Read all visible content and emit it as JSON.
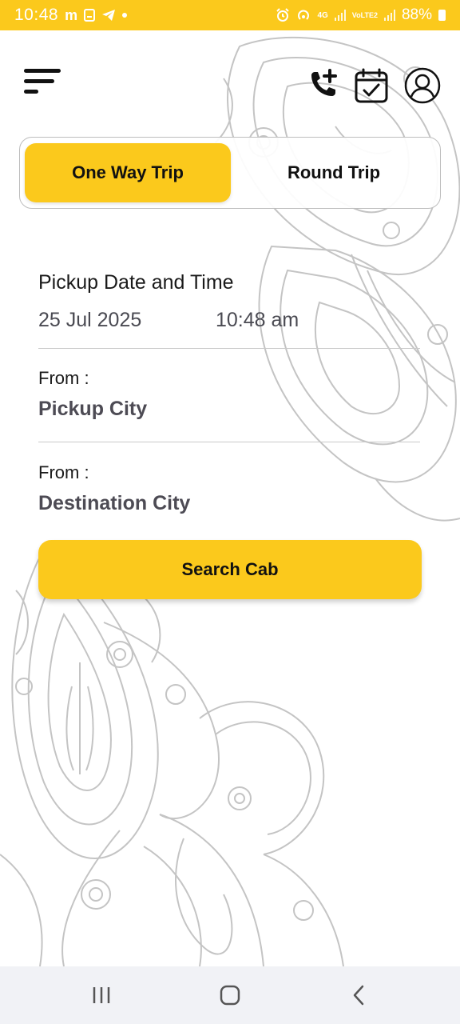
{
  "status_bar": {
    "time": "10:48",
    "left_glyph": "m",
    "network_1": "4G",
    "network_2": "VoLTE2",
    "battery": "88%"
  },
  "header": {
    "menu_icon": "hamburger-icon",
    "icons": [
      "add-call-icon",
      "calendar-check-icon",
      "profile-icon"
    ]
  },
  "trip_toggle": {
    "tabs": [
      {
        "label": "One Way Trip",
        "active": true
      },
      {
        "label": "Round Trip",
        "active": false
      }
    ]
  },
  "form": {
    "pickup_label": "Pickup Date and Time",
    "date": "25 Jul 2025",
    "time": "10:48 am",
    "from_label_1": "From :",
    "pickup_city": "Pickup City",
    "from_label_2": "From :",
    "destination_city": "Destination City"
  },
  "search_button": "Search Cab",
  "colors": {
    "accent": "#fbc91c",
    "text_dark": "#1a1a1a",
    "text_muted": "#4d4b54",
    "nav_bg": "#f1f2f6"
  }
}
